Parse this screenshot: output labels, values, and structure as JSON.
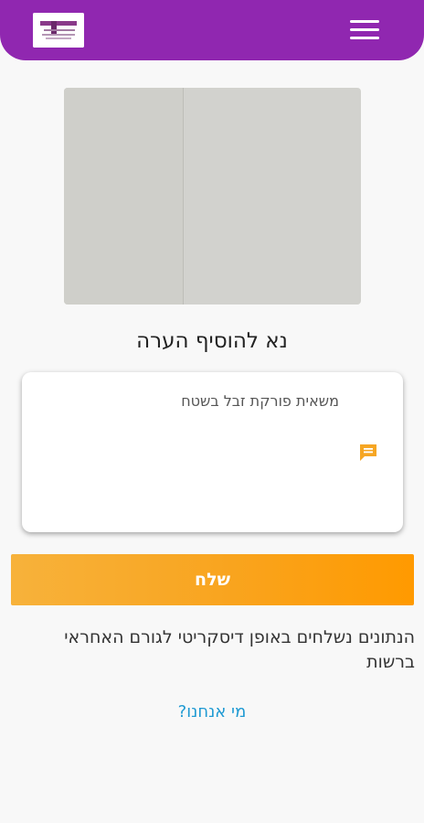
{
  "header": {
    "logo_alt": "logo",
    "menu_icon": "hamburger-menu-icon",
    "background_color": "#9027b0"
  },
  "photo": {
    "description_icon": "uploaded-photo"
  },
  "main": {
    "title": "נא להוסיף הערה",
    "note_placeholder": "משאית פורקת זבל בשטח",
    "note_icon": "comment-icon",
    "send_label": "שלח",
    "send_color": "#f9a41e",
    "notice": "הנתונים נשלחים באופן דיסקריטי לגורם האחראי ברשות",
    "about_link": "מי אנחנו?",
    "link_color": "#1f9ad3"
  }
}
